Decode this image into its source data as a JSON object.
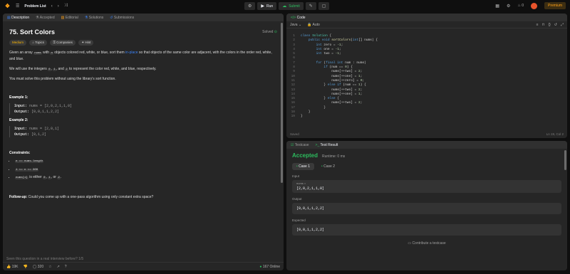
{
  "topbar": {
    "problem_list": "Problem List",
    "run": "Run",
    "submit": "Submit",
    "premium": "Premium",
    "notif_count": "0"
  },
  "left": {
    "tabs": [
      "Description",
      "Accepted",
      "Editorial",
      "Solutions",
      "Submissions"
    ],
    "title": "75. Sort Colors",
    "status": "Solved",
    "chips": [
      "Medium",
      "Topics",
      "Companies",
      "Hint"
    ],
    "p1a": "Given an array ",
    "p1_code": "nums",
    "p1b": " with ",
    "p1_n": "n",
    "p1c": " objects colored red, white, or blue, sort them ",
    "p1_link": "in-place",
    "p1d": " so that objects of the same color are adjacent, with the colors in the order red, white, and blue.",
    "p2a": "We will use the integers ",
    "p2_0": "0",
    "p2_1": "1",
    "p2_and": ", and ",
    "p2_2": "2",
    "p2b": " to represent the color red, white, and blue, respectively.",
    "p3": "You must solve this problem without using the library's sort function.",
    "ex1_title": "Example 1:",
    "ex1_input_label": "Input:",
    "ex1_input": "nums = [2,0,2,1,1,0]",
    "ex1_output_label": "Output:",
    "ex1_output": "[0,0,1,1,2,2]",
    "ex2_title": "Example 2:",
    "ex2_input_label": "Input:",
    "ex2_input": "nums = [2,0,1]",
    "ex2_output_label": "Output:",
    "ex2_output": "[0,1,2]",
    "constraints_title": "Constraints:",
    "c1": "n == nums.length",
    "c2": "1 <= n <= 300",
    "c3_code": "nums[i]",
    "c3_text": " is either ",
    "c3_0": "0",
    "c3_1": "1",
    "c3_or": ", or ",
    "c3_2": "2",
    "followup_label": "Follow-up:",
    "followup": " Could you come up with a one-pass algorithm using only constant extra space?",
    "seen": "Seen this question in a real interview before?   1/5",
    "likes": "19K",
    "comments": "320",
    "online": "167 Online"
  },
  "code": {
    "tab": "Code",
    "lang": "Java",
    "auto": "Auto",
    "saved": "Saved",
    "pos": "Ln 19, Col 2",
    "lines": [
      "class Solution {",
      "    public void sortColors(int[] nums) {",
      "        int zero = -1;",
      "        int one = -1;",
      "        int two = -1;",
      "",
      "        for (final int num : nums)",
      "            if (num == 0) {",
      "                nums[++two] = 2;",
      "                nums[++one] = 1;",
      "                nums[++zero] = 0;",
      "            } else if (num == 1) {",
      "                nums[++two] = 2;",
      "                nums[++one] = 1;",
      "            } else {",
      "                nums[++two] = 2;",
      "            }",
      "    }",
      "}"
    ]
  },
  "result": {
    "tabs": [
      "Testcase",
      "Test Result"
    ],
    "status": "Accepted",
    "runtime": "Runtime: 0 ms",
    "cases": [
      "Case 1",
      "Case 2"
    ],
    "input_label": "Input",
    "var_name": "nums =",
    "input": "[2,0,2,1,1,0]",
    "output_label": "Output",
    "output": "[0,0,1,1,2,2]",
    "expected_label": "Expected",
    "expected": "[0,0,1,1,2,2]",
    "contribute": "Contribute a testcase"
  },
  "colors": {
    "accent": "#ffa116",
    "green": "#2cbb5d",
    "link": "#3b82f6"
  }
}
